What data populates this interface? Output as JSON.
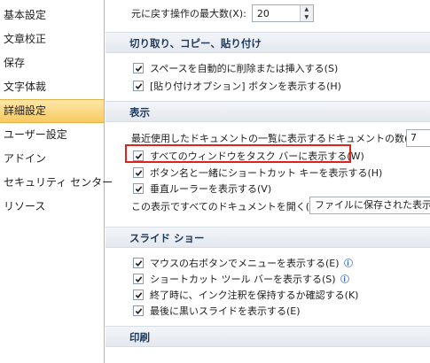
{
  "sidebar": {
    "items": [
      {
        "label": "基本設定"
      },
      {
        "label": "文章校正"
      },
      {
        "label": "保存"
      },
      {
        "label": "文字体裁"
      },
      {
        "label": "詳細設定",
        "selected": true
      },
      {
        "label": "ユーザー設定"
      },
      {
        "label": "アドイン"
      },
      {
        "label": "セキュリティ センター"
      },
      {
        "label": "リソース"
      }
    ]
  },
  "undo": {
    "label": "元に戻す操作の最大数(X):",
    "value": "20"
  },
  "sections": {
    "cut_copy_paste": {
      "title": "切り取り、コピー、貼り付け",
      "options": [
        {
          "label": "スペースを自動的に削除または挿入する(S)",
          "checked": true
        },
        {
          "label": "[貼り付けオプション] ボタンを表示する(H)",
          "checked": true
        }
      ]
    },
    "display": {
      "title": "表示",
      "recent_docs_label": "最近使用したドキュメントの一覧に表示するドキュメントの数(R):",
      "recent_docs_value": "7",
      "options": [
        {
          "label": "すべてのウィンドウをタスク バーに表示する(W)",
          "checked": true
        },
        {
          "label": "ボタン名と一緒にショートカット キーを表示する(H)",
          "checked": true
        },
        {
          "label": "垂直ルーラーを表示する(V)",
          "checked": true
        }
      ],
      "open_docs_label": "この表示ですべてのドキュメントを開く(O):",
      "open_docs_value": "ファイルに保存された表示"
    },
    "slideshow": {
      "title": "スライド ショー",
      "options": [
        {
          "label": "マウスの右ボタンでメニューを表示する(E)",
          "checked": true,
          "info": true
        },
        {
          "label": "ショートカット ツール バーを表示する(S)",
          "checked": true,
          "info": true
        },
        {
          "label": "終了時に、インク注釈を保持するか確認する(K)",
          "checked": true
        },
        {
          "label": "最後に黒いスライドを表示する(E)",
          "checked": true
        }
      ]
    },
    "print": {
      "title": "印刷"
    }
  },
  "icons": {
    "checkmark": "check-icon",
    "info": "info-icon"
  },
  "colors": {
    "highlight": "#e0221c",
    "selected_nav": "#f8c960"
  }
}
